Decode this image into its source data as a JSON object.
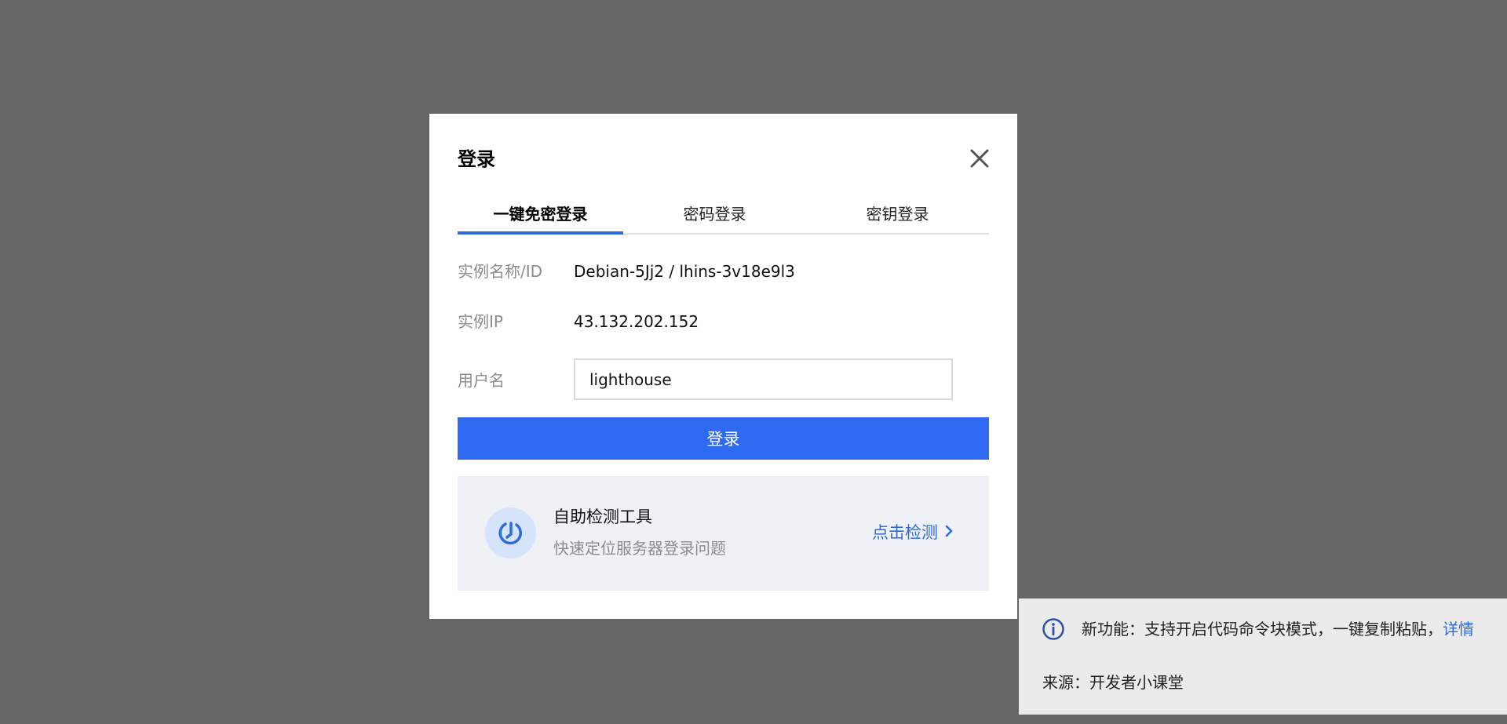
{
  "dialog": {
    "title": "登录",
    "tabs": [
      {
        "label": "一键免密登录",
        "active": true
      },
      {
        "label": "密码登录",
        "active": false
      },
      {
        "label": "密钥登录",
        "active": false
      }
    ],
    "fields": {
      "instance_label": "实例名称/ID",
      "instance_value": "Debian-5Jj2 / lhins-3v18e9l3",
      "ip_label": "实例IP",
      "ip_value": "43.132.202.152",
      "username_label": "用户名",
      "username_value": "lighthouse"
    },
    "login_button": "登录",
    "tool": {
      "title": "自助检测工具",
      "description": "快速定位服务器登录问题",
      "link": "点击检测"
    }
  },
  "notice": {
    "text": "新功能：支持开启代码命令块模式，一键复制粘贴，",
    "link": "详情",
    "source": "来源：开发者小课堂"
  },
  "colors": {
    "accent": "#2f6bf2",
    "backdrop": "#666666"
  }
}
